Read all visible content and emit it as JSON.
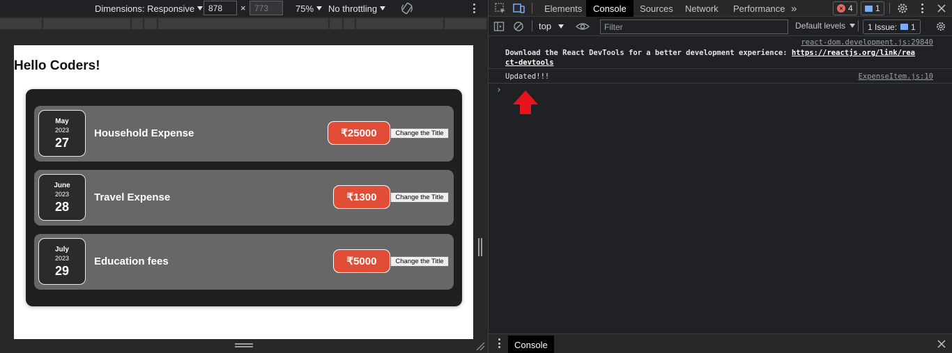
{
  "device_toolbar": {
    "dimensions_label": "Dimensions: Responsive",
    "width_value": "878",
    "height_value": "773",
    "times": "×",
    "zoom": "75%",
    "throttling": "No throttling"
  },
  "page": {
    "heading": "Hello Coders!",
    "expenses": [
      {
        "month": "May",
        "year": "2023",
        "day": "27",
        "title": "Household Expense",
        "amount": "₹25000",
        "button": "Change the Title"
      },
      {
        "month": "June",
        "year": "2023",
        "day": "28",
        "title": "Travel Expense",
        "amount": "₹1300",
        "button": "Change the Title"
      },
      {
        "month": "July",
        "year": "2023",
        "day": "29",
        "title": "Education fees",
        "amount": "₹5000",
        "button": "Change the Title"
      }
    ]
  },
  "devtools": {
    "tabs": [
      "Elements",
      "Console",
      "Sources",
      "Network",
      "Performance"
    ],
    "active_tab": "Console",
    "more_tabs": "»",
    "error_count": "4",
    "message_count": "1",
    "console_toolbar": {
      "context": "top",
      "filter_placeholder": "Filter",
      "levels": "Default levels",
      "issues_label": "1 Issue:",
      "issues_count": "1"
    },
    "logs": [
      {
        "source": "react-dom.development.js:29840",
        "text": "Download the React DevTools for a better development experience: ",
        "link_line1": "https://reactjs.org/link/rea",
        "link_line2": "ct-devtools"
      },
      {
        "source": "ExpenseItem.js:10",
        "text": "Updated!!!"
      }
    ],
    "prompt": "›",
    "drawer_tab": "Console",
    "colors": {
      "accent": "#7cacf8",
      "error": "#e46962",
      "arrow": "#e8131b",
      "price": "#e24d37"
    }
  }
}
